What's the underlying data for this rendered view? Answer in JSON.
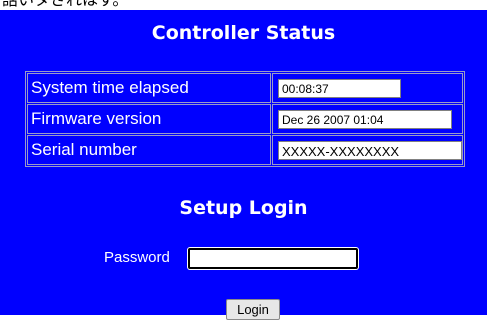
{
  "header_fragment": "話いタされはす。",
  "title": "Controller Status",
  "status_rows": [
    {
      "label": "System time elapsed",
      "value": "00:08:37"
    },
    {
      "label": "Firmware version",
      "value": "Dec 26 2007 01:04"
    },
    {
      "label": "Serial number",
      "value": "XXXXX-XXXXXXXX"
    }
  ],
  "login": {
    "title": "Setup Login",
    "password_label": "Password",
    "password_value": "",
    "button_label": "Login"
  },
  "colors": {
    "panel_background": "#0000ff",
    "text": "#ffffff"
  }
}
